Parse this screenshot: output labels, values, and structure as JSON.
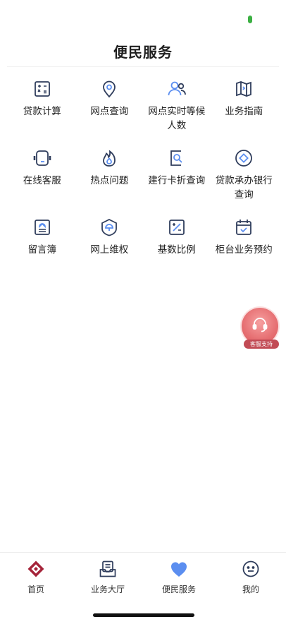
{
  "page": {
    "title": "便民服务"
  },
  "services": [
    {
      "label": "贷款计算",
      "icon": "calculator-icon"
    },
    {
      "label": "网点查询",
      "icon": "location-pin-icon"
    },
    {
      "label": "网点实时等候人数",
      "icon": "people-icon"
    },
    {
      "label": "业务指南",
      "icon": "map-guide-icon"
    },
    {
      "label": "在线客服",
      "icon": "headset-icon"
    },
    {
      "label": "热点问题",
      "icon": "flame-icon"
    },
    {
      "label": "建行卡折查询",
      "icon": "card-search-icon"
    },
    {
      "label": "贷款承办银行查询",
      "icon": "bank-search-icon"
    },
    {
      "label": "留言簿",
      "icon": "message-book-icon"
    },
    {
      "label": "网上维权",
      "icon": "shield-umbrella-icon"
    },
    {
      "label": "基数比例",
      "icon": "ratio-icon"
    },
    {
      "label": "柜台业务预约",
      "icon": "calendar-check-icon"
    }
  ],
  "floating_support": {
    "label": "客服支持",
    "icon": "customer-service-icon"
  },
  "tabbar": {
    "items": [
      {
        "label": "首页",
        "icon": "home-logo-icon"
      },
      {
        "label": "业务大厅",
        "icon": "business-hall-icon"
      },
      {
        "label": "便民服务",
        "icon": "heart-icon",
        "active": true
      },
      {
        "label": "我的",
        "icon": "smiley-profile-icon"
      }
    ]
  },
  "colors": {
    "icon": "#2f3d5c",
    "accent": "#5b8ef0",
    "brand_red": "#a5243a",
    "support": "#e66f72"
  }
}
